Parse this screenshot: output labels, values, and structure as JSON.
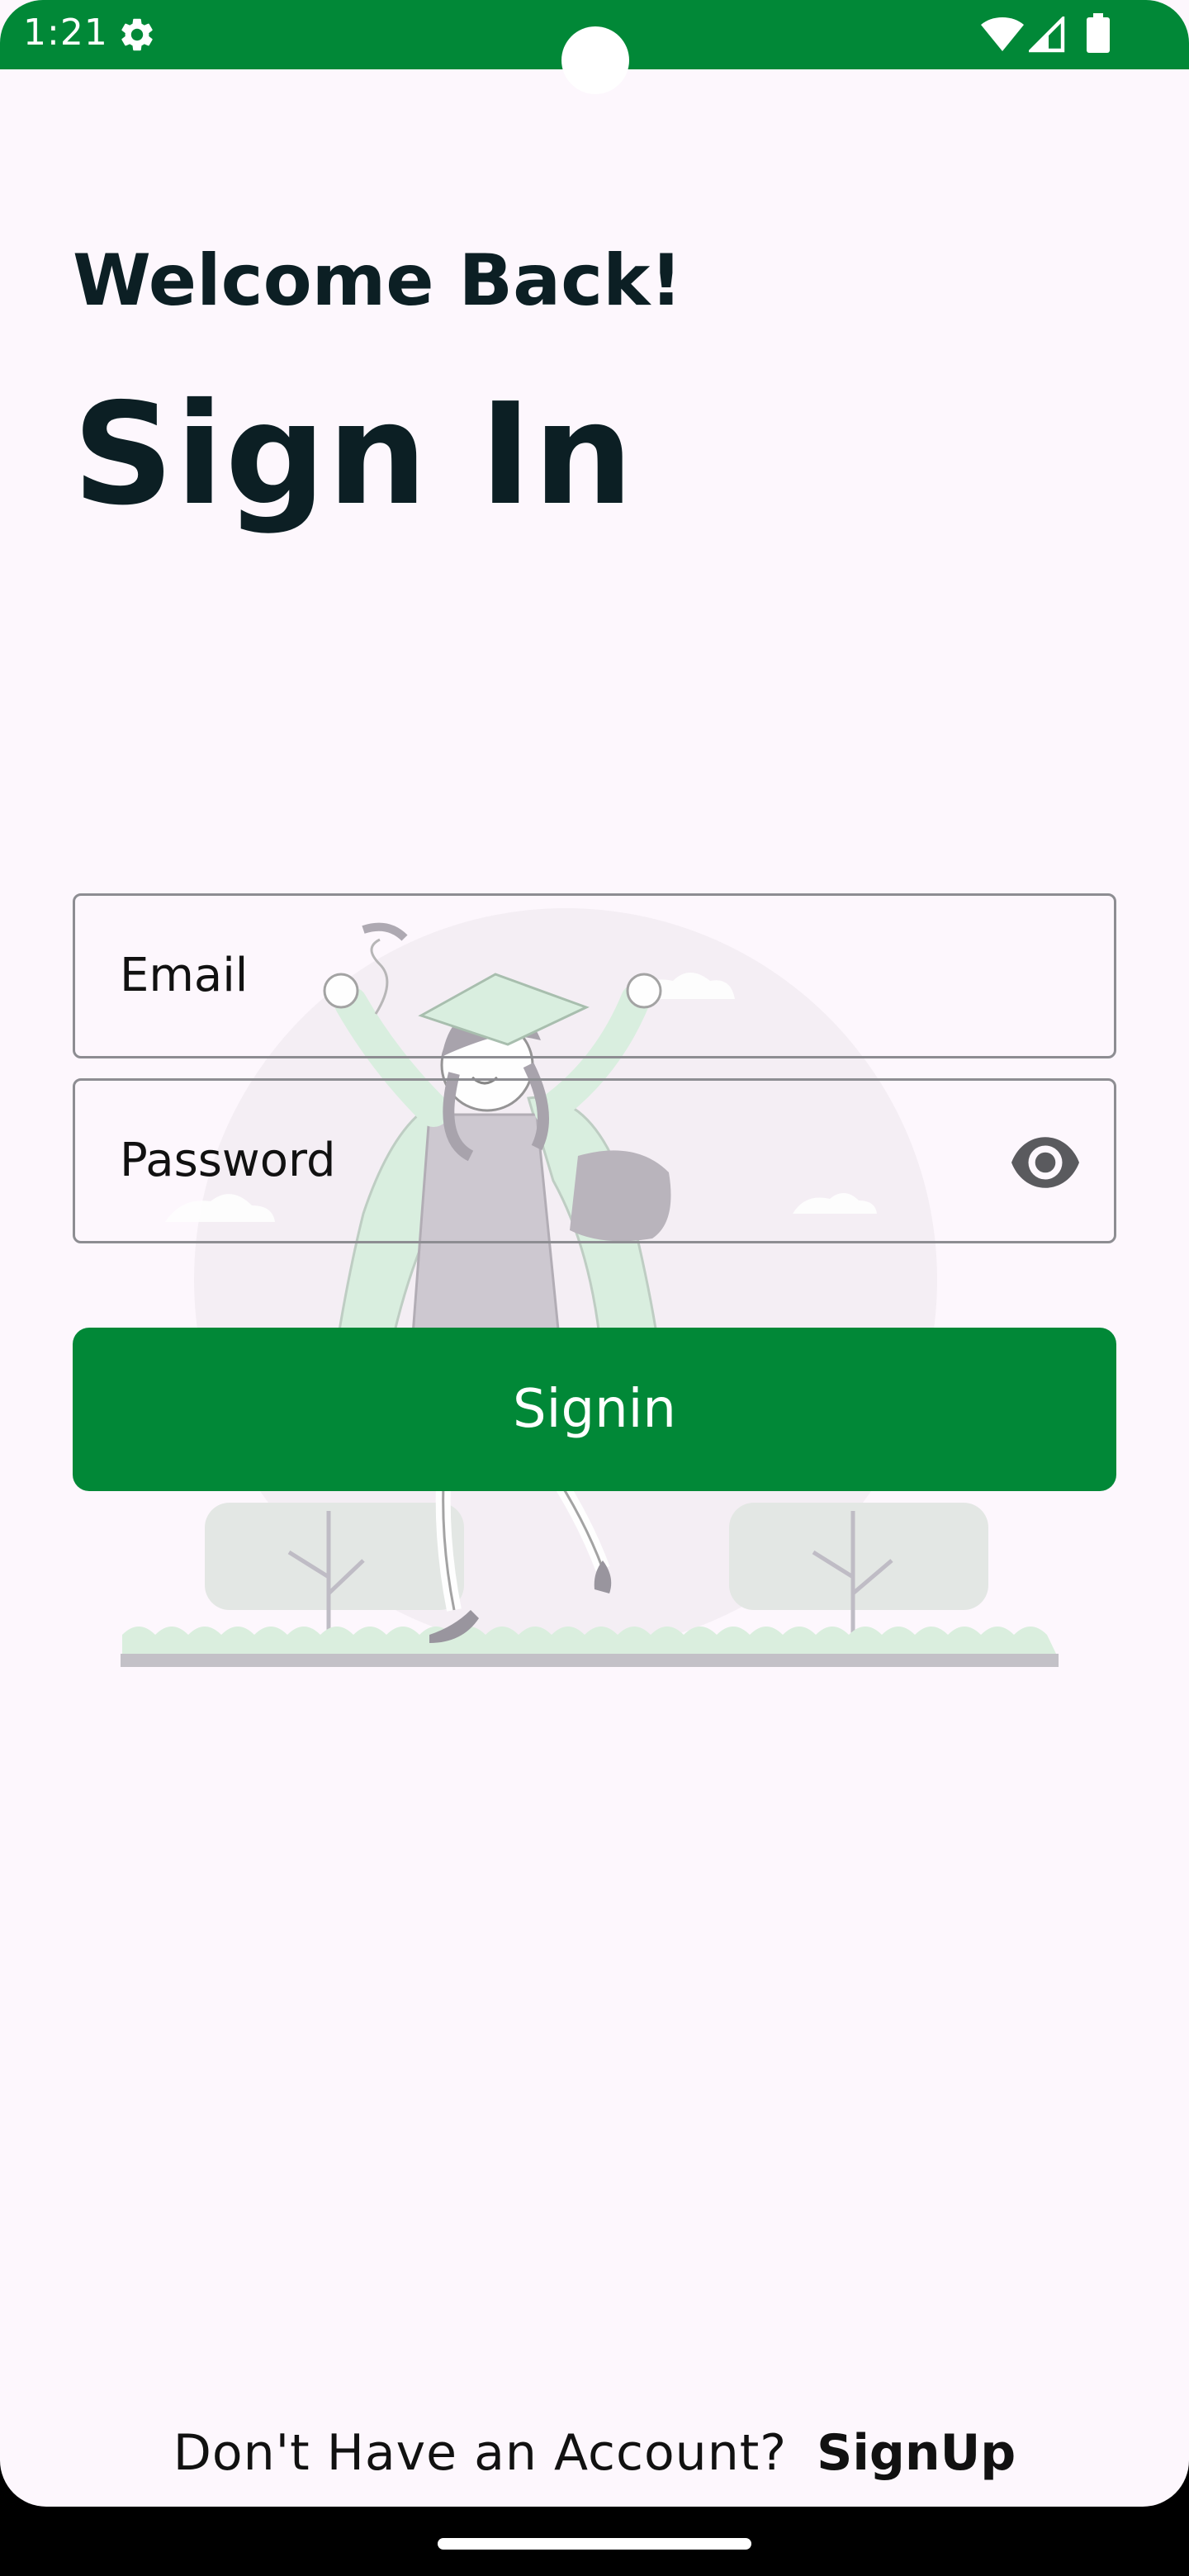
{
  "status_bar": {
    "time": "1:21",
    "color": "#018837",
    "icons": [
      "settings-gear-icon",
      "wifi-icon",
      "signal-icon",
      "battery-icon"
    ]
  },
  "header": {
    "welcome": "Welcome Back!",
    "title": "Sign In"
  },
  "form": {
    "email_label": "Email",
    "password_label": "Password",
    "password_toggle_icon": "eye-icon",
    "submit_label": "Signin",
    "submit_color": "#018837"
  },
  "footer": {
    "prompt": "Don't Have an Account?",
    "link": "SignUp"
  },
  "illustration": {
    "subject": "graduate-jumping-illustration"
  }
}
